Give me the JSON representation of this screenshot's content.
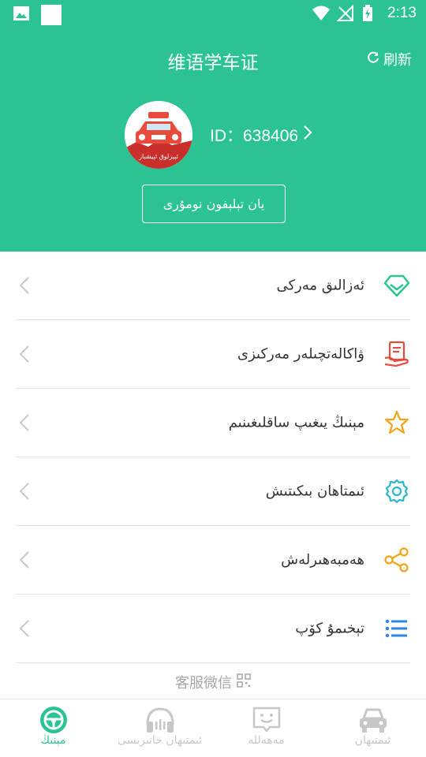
{
  "status_bar": {
    "time": "2:13"
  },
  "header": {
    "title": "维语学车证",
    "refresh_label": "刷新",
    "avatar_caption": "ئېيزلوق ئېيشبار",
    "user_id": "ID：638406",
    "bind_phone_label": "يان تېلېفون نومۇرى"
  },
  "menu": {
    "items": [
      {
        "label": "ئەزالىق مەركى",
        "icon": "diamond-icon",
        "color": "#2bc393"
      },
      {
        "label": "ۋاكالەتچىلەر مەركىزى",
        "icon": "document-hand-icon",
        "color": "#e84a3c"
      },
      {
        "label": "مېنىڭ يىغىپ ساقلىغىنىم",
        "icon": "star-icon",
        "color": "#f2a417"
      },
      {
        "label": "ئىمتاھان بىكىتىش",
        "icon": "gear-icon",
        "color": "#2bb7c9"
      },
      {
        "label": "ھەمبەھىرلەش",
        "icon": "share-icon",
        "color": "#f2a417"
      },
      {
        "label": "تېخىمۇ كۆپ",
        "icon": "list-icon",
        "color": "#2e86de"
      }
    ]
  },
  "service": {
    "label": "客服微信"
  },
  "bottom_nav": {
    "items": [
      {
        "label": "مېنىڭ",
        "icon": "steering-wheel-icon",
        "active": true
      },
      {
        "label": "ئىمتىھان خاتىرىسى",
        "icon": "headphones-icon",
        "active": false
      },
      {
        "label": "مەھەللە",
        "icon": "chat-face-icon",
        "active": false
      },
      {
        "label": "ئىمتىھان",
        "icon": "car-icon",
        "active": false
      }
    ]
  },
  "colors": {
    "brand": "#2bc393",
    "divider": "#e4e4e4",
    "inactive": "#c7c7c7"
  }
}
